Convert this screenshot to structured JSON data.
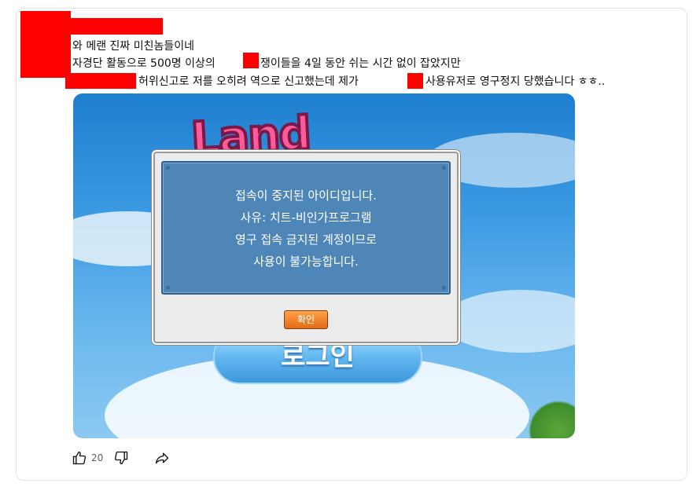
{
  "post": {
    "lines": [
      "와 메랜 진짜 미친놈들이네",
      "자경단 활동으로 500명 이상의",
      "쟁이들을 4일 동안 쉬는 시간 없이 잡았지만",
      "허위신고로 저를 오히려 역으로 신고했는데 제가",
      "사용유저로 영구정지 당했습니다 ㅎㅎ.."
    ]
  },
  "game": {
    "logo_text": "Land",
    "login_label": "로그인",
    "dialog": {
      "lines": [
        "접속이 중지된 아이디입니다.",
        "사유: 치트-비인가프로그램",
        "영구 접속 금지된 계정이므로",
        "사용이 불가능합니다."
      ],
      "ok_label": "확인"
    }
  },
  "actions": {
    "like_count": "20",
    "like_icon": "thumbs-up-icon",
    "dislike_icon": "thumbs-down-icon",
    "share_icon": "share-icon"
  },
  "colors": {
    "redaction": "#ff0000",
    "dialog_panel": "#4f86b8",
    "ok_button": "#e46b14"
  }
}
